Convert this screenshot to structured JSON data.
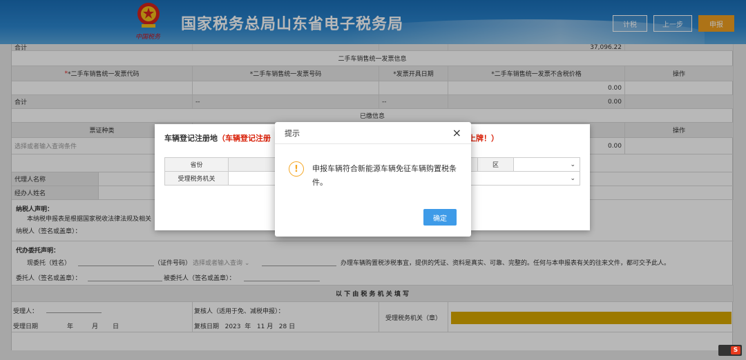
{
  "header": {
    "emblem_text": "中国税务",
    "title": "国家税务总局山东省电子税务局",
    "btn_calc": "计税",
    "btn_prev": "上一步",
    "btn_declare": "申报"
  },
  "form": {
    "top_total": {
      "label": "合计",
      "value": "37,096.22"
    },
    "section_invoice": "二手车销售统一发票信息",
    "invoice_headers": [
      "*二手车销售统一发票代码",
      "*二手车销售统一发票号码",
      "*发票开具日期",
      "*二手车销售统一发票不含税价格",
      "操作"
    ],
    "invoice_row_value": "0.00",
    "invoice_total": {
      "label": "合计",
      "c2": "--",
      "c3": "--",
      "value": "0.00"
    },
    "section_paid": "已缴信息",
    "paid_headers": {
      "col1": "票证种类",
      "op": "操作"
    },
    "paid_placeholder": "选择或者输入查询条件",
    "paid_value": "0.00",
    "agent_name": "代理人名称",
    "handler_name": "经办人姓名",
    "taxpayer_decl_title": "纳税人声明：",
    "taxpayer_decl_text": "本纳税申报表是根据国家税收法律法规及相关",
    "taxpayer_sign": "纳税人（签名或盖章）：",
    "proxy_title": "代办委托声明：",
    "proxy_entrust": "现委托（姓名）",
    "proxy_id": "（证件号码）",
    "proxy_select": "选择或者输入查询",
    "proxy_text": "办理车辆购置税涉税事宜，提供的凭证、资料是真实、可靠、完整的。任何与本申报表有关的往来文件，都可交予此人。",
    "entruster_sign": "委托人（签名或盖章）：",
    "entrustee_sign": "被委托人（签名或盖章）：",
    "tax_section": "以 下 由 税 务 机 关 填 写",
    "acceptor": "受理人：",
    "reviewer": "复核人（适用于免、减税申报）：",
    "accept_date": "受理日期",
    "year": "年",
    "month": "月",
    "day": "日",
    "review_date_label": "复核日期",
    "review_year": "2023",
    "review_month": "11",
    "review_day": "28",
    "tax_office_seal": "受理税务机关（章）"
  },
  "bg_dialog": {
    "title": "车辆登记注册地",
    "title_red": "（车辆登记注册",
    "warn_tail": "上牌！）",
    "province_label": "省份",
    "district_label": "区",
    "office_label": "受理税务机关"
  },
  "alert": {
    "title": "提示",
    "close": "×",
    "icon": "!",
    "message": "申报车辆符合新能源车辆免征车辆购置税条件。",
    "ok": "确定"
  },
  "tray": {
    "label": "S"
  },
  "colors": {
    "header_blue": "#2b86cf",
    "declare_orange": "#f0a020",
    "ok_blue": "#3e9be8",
    "warn_orange": "#f5a623",
    "required_red": "#e02020"
  }
}
